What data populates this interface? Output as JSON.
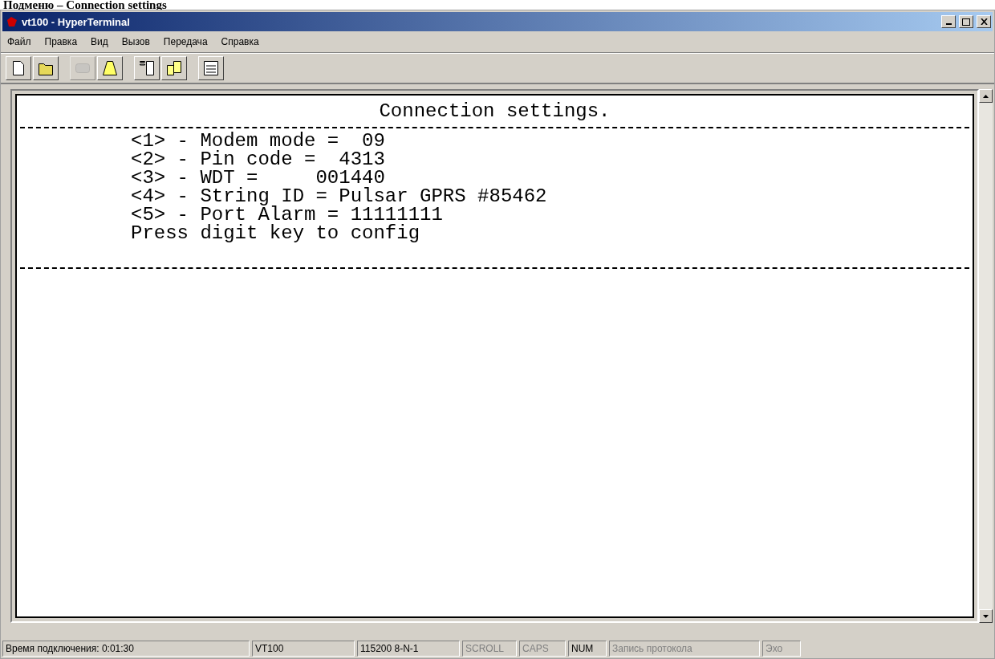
{
  "page_heading": "Подменю – Connection settings",
  "window": {
    "title": "vt100 - HyperTerminal"
  },
  "menu": [
    "Файл",
    "Правка",
    "Вид",
    "Вызов",
    "Передача",
    "Справка"
  ],
  "toolbar": [
    {
      "kind": "new",
      "disabled": false
    },
    {
      "kind": "open",
      "disabled": false
    },
    {
      "kind": "gap"
    },
    {
      "kind": "call",
      "disabled": true
    },
    {
      "kind": "hangup",
      "disabled": false
    },
    {
      "kind": "gap"
    },
    {
      "kind": "send",
      "disabled": false
    },
    {
      "kind": "receive",
      "disabled": false
    },
    {
      "kind": "gap"
    },
    {
      "kind": "properties",
      "disabled": false
    }
  ],
  "terminal": {
    "title": "Connection settings.",
    "lines": [
      "<1> - Modem mode =  09",
      "<2> - Pin code =  4313",
      "<3> - WDT =     001440",
      "<4> - String ID = Pulsar GPRS #85462",
      "<5> - Port Alarm = 11111111",
      "Press digit key to config"
    ]
  },
  "status_bar": [
    {
      "text": "Время подключения: 0:01:30"
    },
    {
      "text": "VT100"
    },
    {
      "text": "115200 8-N-1"
    },
    {
      "text": "SCROLL",
      "active": false
    },
    {
      "text": "CAPS",
      "active": false
    },
    {
      "text": "NUM",
      "active": true
    },
    {
      "text": "Запись протокола",
      "active": false
    },
    {
      "text": "Эхо",
      "active": false
    }
  ]
}
